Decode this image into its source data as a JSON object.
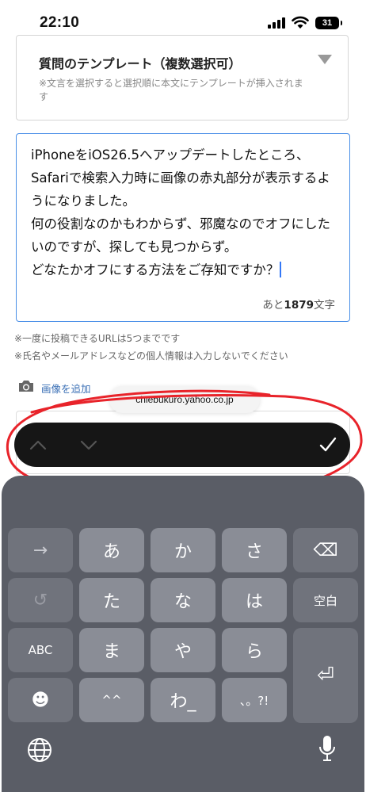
{
  "status_bar": {
    "time": "22:10",
    "battery": "31"
  },
  "template": {
    "title": "質問のテンプレート（複数選択可）",
    "note": "※文言を選択すると選択順に本文にテンプレートが挿入されます"
  },
  "question": {
    "body": "iPhoneをiOS26.5へアップデートしたところ、Safariで検索入力時に画像の赤丸部分が表示するようになりました。\n何の役割なのかもわからず、邪魔なのでオフにしたいのですが、探しても見つからず。\nどなたかオフにする方法をご存知ですか？",
    "remaining_prefix": "あと",
    "remaining_count": "1879",
    "remaining_suffix": "文字"
  },
  "notes": [
    "※一度に投稿できるURLは5つまでです",
    "※氏名やメールアドレスなどの個人情報は入力しないでください"
  ],
  "add_image_label": "画像を追加",
  "url_pill": "chiebukuro.yahoo.co.jp",
  "toolbar": {
    "up_icon": "chevron-up-icon",
    "down_icon": "chevron-down-icon",
    "done_icon": "checkmark-icon"
  },
  "annotation_color": "#e8232a",
  "keyboard": {
    "row1": [
      "→",
      "あ",
      "か",
      "さ",
      "⌫"
    ],
    "row2": [
      "↺",
      "た",
      "な",
      "は",
      "空白"
    ],
    "row3": [
      "ABC",
      "ま",
      "や",
      "ら"
    ],
    "row4": [
      "☻",
      "^^",
      "わ_",
      "、。?!"
    ],
    "return_symbol": "⏎"
  }
}
